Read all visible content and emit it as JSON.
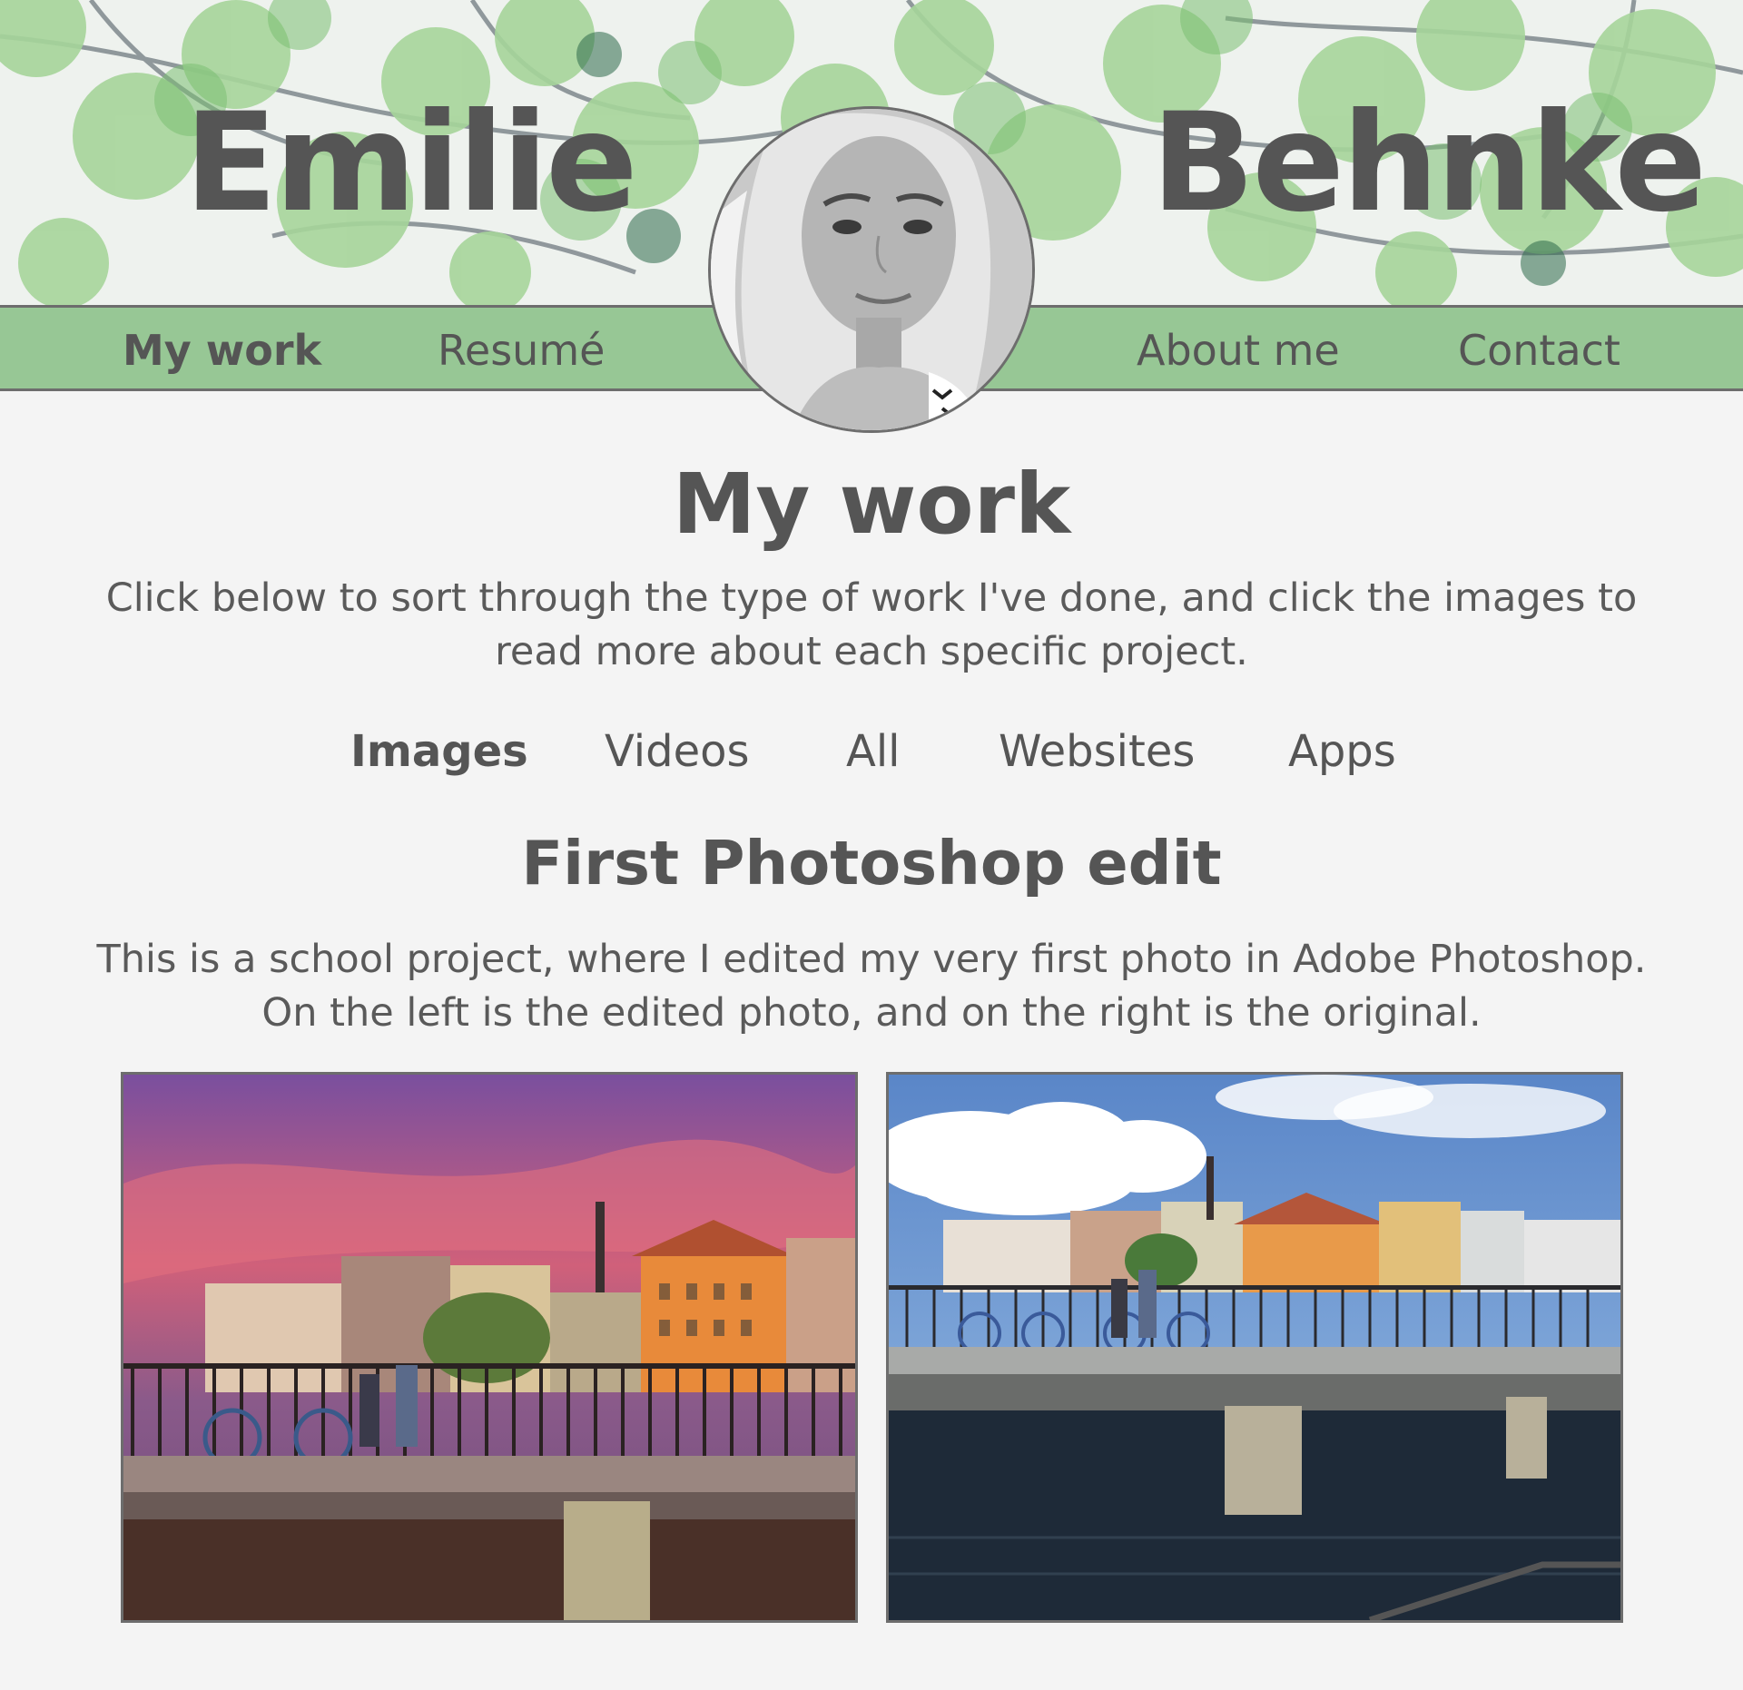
{
  "header": {
    "first_name": "Emilie",
    "last_name": "Behnke",
    "nav": [
      {
        "label": "My work",
        "active": true
      },
      {
        "label": "Resumé",
        "active": false
      },
      {
        "label": "About me",
        "active": false
      },
      {
        "label": "Contact",
        "active": false
      }
    ],
    "accent_color": "#97c795"
  },
  "main": {
    "title": "My work",
    "intro": "Click below to sort through the type of work I've done, and click the images to read more about each specific project.",
    "filters": [
      {
        "label": "Images",
        "active": true
      },
      {
        "label": "Videos",
        "active": false
      },
      {
        "label": "All",
        "active": false
      },
      {
        "label": "Websites",
        "active": false
      },
      {
        "label": "Apps",
        "active": false
      }
    ],
    "project": {
      "title": "First Photoshop edit",
      "description": "This is a school project, where I edited my very first photo in Adobe Photoshop. On the left is the edited photo, and on the right is the original."
    }
  }
}
